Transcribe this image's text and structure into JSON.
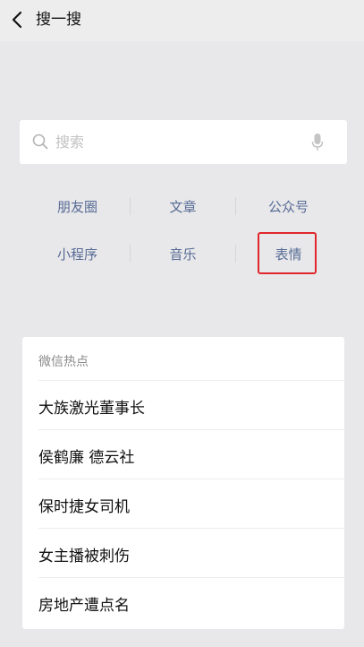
{
  "header": {
    "back_icon": "chevron-left-icon",
    "title": "搜一搜"
  },
  "search": {
    "placeholder": "搜索",
    "value": "",
    "search_icon": "search-icon",
    "voice_icon": "microphone-icon"
  },
  "categories": [
    {
      "label": "朋友圈"
    },
    {
      "label": "文章"
    },
    {
      "label": "公众号"
    },
    {
      "label": "小程序"
    },
    {
      "label": "音乐"
    },
    {
      "label": "表情",
      "highlighted": true
    }
  ],
  "colors": {
    "link_blue": "#576b95",
    "highlight_red": "#e0262b",
    "background": "#ededed"
  },
  "hot": {
    "title": "微信热点",
    "items": [
      {
        "label": "大族激光董事长"
      },
      {
        "label": "侯鹤廉 德云社"
      },
      {
        "label": "保时捷女司机"
      },
      {
        "label": "女主播被刺伤"
      },
      {
        "label": "房地产遭点名"
      }
    ]
  }
}
